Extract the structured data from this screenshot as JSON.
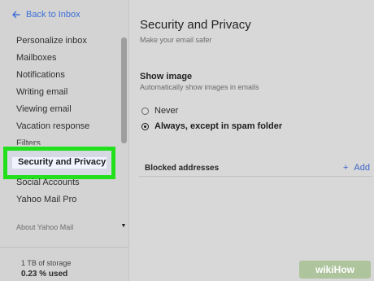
{
  "nav": {
    "back_label": "Back to Inbox",
    "items": [
      {
        "label": "Personalize inbox"
      },
      {
        "label": "Mailboxes"
      },
      {
        "label": "Notifications"
      },
      {
        "label": "Writing email"
      },
      {
        "label": "Viewing email"
      },
      {
        "label": "Vacation response"
      },
      {
        "label": "Filters"
      }
    ],
    "active_label": "Security and Privacy",
    "after_items": [
      {
        "label": "Social Accounts"
      },
      {
        "label": "Yahoo Mail Pro"
      }
    ],
    "about_label": "About Yahoo Mail"
  },
  "storage": {
    "capacity": "1 TB of storage",
    "used": "0.23 % used"
  },
  "main": {
    "title": "Security and Privacy",
    "subtitle": "Make your email safer",
    "show_image": {
      "title": "Show image",
      "subtitle": "Automatically show images in emails",
      "options": [
        {
          "label": "Never",
          "selected": false
        },
        {
          "label": "Always, except in spam folder",
          "selected": true
        }
      ]
    },
    "blocked": {
      "label": "Blocked addresses",
      "add_label": "Add",
      "add_icon": "+"
    }
  },
  "colors": {
    "accent": "#3d6fd6",
    "highlight_border": "#22e01b"
  },
  "watermark": "wikiHow"
}
